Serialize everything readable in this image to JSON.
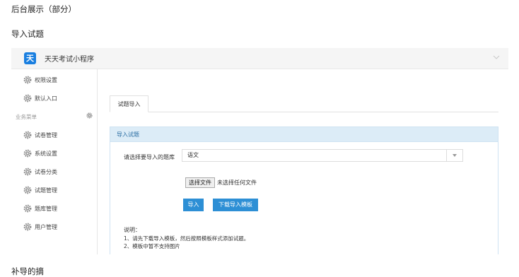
{
  "doc": {
    "title": "后台展示（部分）",
    "subtitle": "导入试题",
    "next_heading": "补导的摘"
  },
  "app": {
    "logo_char": "天",
    "title": "天天考试小程序"
  },
  "sidebar": {
    "top_items": [
      {
        "label": "权限设置",
        "icon": "gear-icon"
      },
      {
        "label": "默认入口",
        "icon": "gear-icon"
      }
    ],
    "group_label": "业务菜单",
    "group_items": [
      {
        "label": "试卷管理",
        "icon": "gear-icon"
      },
      {
        "label": "系统设置",
        "icon": "gear-icon"
      },
      {
        "label": "试卷分类",
        "icon": "gear-icon"
      },
      {
        "label": "试题管理",
        "icon": "gear-icon"
      },
      {
        "label": "题库管理",
        "icon": "gear-icon"
      },
      {
        "label": "用户管理",
        "icon": "gear-icon"
      }
    ]
  },
  "content": {
    "tab_label": "试题导入",
    "panel_title": "导入试题",
    "form_label": "请选择要导入的题库",
    "select_value": "语文",
    "file_button": "选择文件",
    "file_status": "未选择任何文件",
    "import_button": "导入",
    "download_button": "下载导入模板",
    "note_title": "说明：",
    "note_lines": [
      "1、请先下载导入模板，然后按照模板样式添加试题。",
      "2、模板中暂不支持图片"
    ]
  },
  "colors": {
    "accent": "#2d8fd5",
    "panel_header": "#dcecf7",
    "logo": "#1a7fe0"
  }
}
